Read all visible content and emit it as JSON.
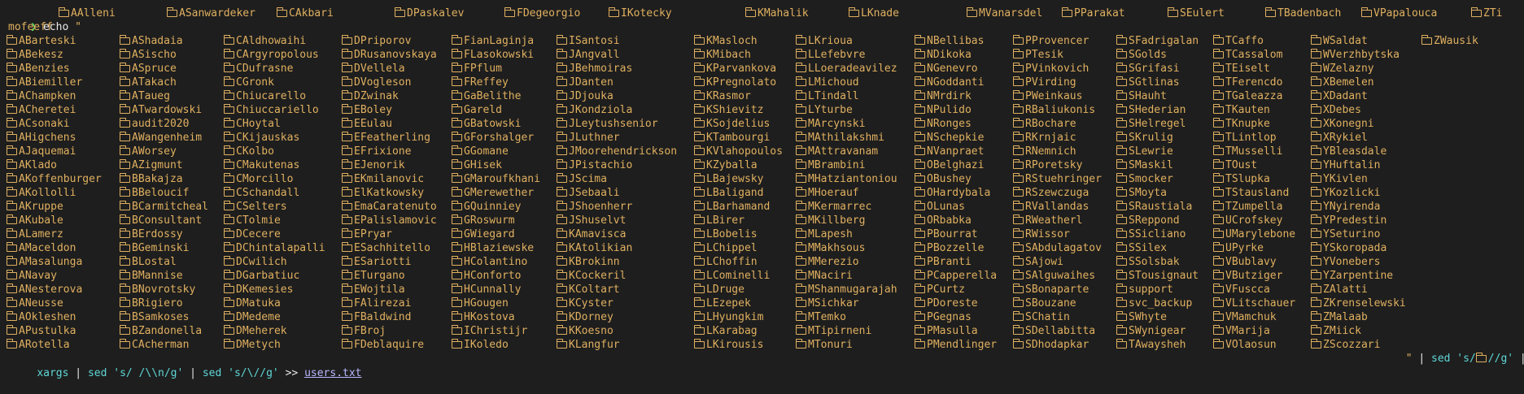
{
  "prompt": {
    "symbol": "❯",
    "command": "echo ",
    "open_quote": "\""
  },
  "first_line_items": [
    "AAlleni",
    "ASanwardeker",
    "CAkbari",
    "DPaskalev",
    "FDegeorgio",
    "IKotecky",
    "KMahalik",
    "LKnade",
    "MVanarsdel",
    "PParakat",
    "SEulert",
    "TBadenbach",
    "VPapalouca",
    "ZTi"
  ],
  "wrap_text": "mofeeff",
  "columns": [
    [
      "ABarteski",
      "ABekesz",
      "ABenzies",
      "ABiemiller",
      "AChampken",
      "ACheretei",
      "ACsonaki",
      "AHigchens",
      "AJaquemai",
      "AKlado",
      "AKoffenburger",
      "AKollolli",
      "AKruppe",
      "AKubale",
      "ALamerz",
      "AMaceldon",
      "AMasalunga",
      "ANavay",
      "ANesterova",
      "ANeusse",
      "AOkleshen",
      "APustulka",
      "ARotella"
    ],
    [
      "AShadaia",
      "ASischo",
      "ASpruce",
      "ATakach",
      "ATaueg",
      "ATwardowski",
      "audit2020",
      "AWangenheim",
      "AWorsey",
      "AZigmunt",
      "BBakajza",
      "BBeloucif",
      "BCarmitcheal",
      "BConsultant",
      "BErdossy",
      "BGeminski",
      "BLostal",
      "BMannise",
      "BNovrotsky",
      "BRigiero",
      "BSamkoses",
      "BZandonella",
      "CAcherman"
    ],
    [
      "CAldhowaihi",
      "CArgyropolous",
      "CDufrasne",
      "CGronk",
      "Chiucarello",
      "Chiuccariello",
      "CHoytal",
      "CKijauskas",
      "CKolbo",
      "CMakutenas",
      "CMorcillo",
      "CSchandall",
      "CSelters",
      "CTolmie",
      "DCecere",
      "DChintalapalli",
      "DCwilich",
      "DGarbatiuc",
      "DKemesies",
      "DMatuka",
      "DMedeme",
      "DMeherek",
      "DMetych"
    ],
    [
      "DPriporov",
      "DRusanovskaya",
      "DVellela",
      "DVogleson",
      "DZwinak",
      "EBoley",
      "EEulau",
      "EFeatherling",
      "EFrixione",
      "EJenorik",
      "EKmilanovic",
      "ElKatkowsky",
      "EmaCaratenuto",
      "EPalislamovic",
      "EPryar",
      "ESachhitello",
      "ESariotti",
      "ETurgano",
      "EWojtila",
      "FAlirezai",
      "FBaldwind",
      "FBroj",
      "FDeblaquire"
    ],
    [
      "FianLaginja",
      "FLasokowski",
      "FPflum",
      "FReffey",
      "GaBelithe",
      "Gareld",
      "GBatowski",
      "GForshalger",
      "GGomane",
      "GHisek",
      "GMaroufkhani",
      "GMerewether",
      "GQuinniey",
      "GRoswurm",
      "GWiegard",
      "HBlaziewske",
      "HColantino",
      "HConforto",
      "HCunnally",
      "HGougen",
      "HKostova",
      "IChristijr",
      "IKoledo"
    ],
    [
      "ISantosi",
      "JAngvall",
      "JBehmoiras",
      "JDanten",
      "JDjouka",
      "JKondziola",
      "JLeytushsenior",
      "JLuthner",
      "JMoorehendrickson",
      "JPistachio",
      "JScima",
      "JSebaali",
      "JShoenherr",
      "JShuselvt",
      "KAmavisca",
      "KAtolikian",
      "KBrokinn",
      "KCockeril",
      "KColtart",
      "KCyster",
      "KDorney",
      "KKoesno",
      "KLangfur"
    ],
    [
      "KMasloch",
      "KMibach",
      "KParvankova",
      "KPregnolato",
      "KRasmor",
      "KShievitz",
      "KSojdelius",
      "KTambourgi",
      "KVlahopoulos",
      "KZyballa",
      "LBajewsky",
      "LBaligand",
      "LBarhamand",
      "LBirer",
      "LBobelis",
      "LChippel",
      "LChoffin",
      "LCominelli",
      "LDruge",
      "LEzepek",
      "LHyungkim",
      "LKarabag",
      "LKirousis"
    ],
    [
      "LKrioua",
      "LLefebvre",
      "LLoeradeavilez",
      "LMichoud",
      "LTindall",
      "LYturbe",
      "MArcynski",
      "MAthilakshmi",
      "MAttravanam",
      "MBrambini",
      "MHatziantoniou",
      "MHoerauf",
      "MKermarrec",
      "MKillberg",
      "MLapesh",
      "MMakhsous",
      "MMerezio",
      "MNaciri",
      "MShanmugarajah",
      "MSichkar",
      "MTemko",
      "MTipirneni",
      "MTonuri"
    ],
    [
      "NBellibas",
      "NDikoka",
      "NGenevro",
      "NGoddanti",
      "NMrdirk",
      "NPulido",
      "NRonges",
      "NSchepkie",
      "NVanpraet",
      "OBelghazi",
      "OBushey",
      "OHardybala",
      "OLunas",
      "ORbabka",
      "PBourrat",
      "PBozzelle",
      "PBranti",
      "PCapperella",
      "PCurtz",
      "PDoreste",
      "PGegnas",
      "PMasulla",
      "PMendlinger"
    ],
    [
      "PProvencer",
      "PTesik",
      "PVinkovich",
      "PVirding",
      "PWeinkaus",
      "RBaliukonis",
      "RBochare",
      "RKrnjaic",
      "RNemnich",
      "RPoretsky",
      "RStuehringer",
      "RSzewczuga",
      "RVallandas",
      "RWeatherl",
      "RWissor",
      "SAbdulagatov",
      "SAjowi",
      "SAlguwaihes",
      "SBonaparte",
      "SBouzane",
      "SChatin",
      "SDellabitta",
      "SDhodapkar"
    ],
    [
      "SFadrigalan",
      "SGolds",
      "SGrifasi",
      "SGtlinas",
      "SHauht",
      "SHederian",
      "SHelregel",
      "SKrulig",
      "SLewrie",
      "SMaskil",
      "Smocker",
      "SMoyta",
      "SRaustiala",
      "SReppond",
      "SSicliano",
      "SSilex",
      "SSolsbak",
      "STousignaut",
      "support",
      "svc_backup",
      "SWhyte",
      "SWynigear",
      "TAwaysheh"
    ],
    [
      "TCaffo",
      "TCassalom",
      "TEiselt",
      "TFerencdo",
      "TGaleazza",
      "TKauten",
      "TKnupke",
      "TLintlop",
      "TMusselli",
      "TOust",
      "TSlupka",
      "TStausland",
      "TZumpella",
      "UCrofskey",
      "UMarylebone",
      "UPyrke",
      "VBublavy",
      "VButziger",
      "VFuscca",
      "VLitschauer",
      "VMamchuk",
      "VMarija",
      "VOlaosun"
    ],
    [
      "WSaldat",
      "WVerzhbytska",
      "WZelazny",
      "XBemelen",
      "XDadant",
      "XDebes",
      "XKonegni",
      "XRykiel",
      "YBleasdale",
      "YHuftalin",
      "YKivlen",
      "YKozlicki",
      "YNyirenda",
      "YPredestin",
      "YSeturino",
      "YSkoropada",
      "YVonebers",
      "YZarpentine",
      "ZAlatti",
      "ZKrenselewski",
      "ZMalaab",
      "ZMiick",
      "ZScozzari"
    ],
    [
      "ZWausik"
    ]
  ],
  "last_suffix": {
    "close_quote": "\"",
    "pipe": " | ",
    "sed1": "sed 's/",
    "sed1_tail": "//g'",
    "trail": " |"
  },
  "tail": {
    "xargs": "xargs",
    "pipe": " | ",
    "sed2": "sed 's/ /\\\\n/g'",
    "sed3": "sed 's/\\//g'",
    "redirect": " >> ",
    "target": "users.txt"
  }
}
